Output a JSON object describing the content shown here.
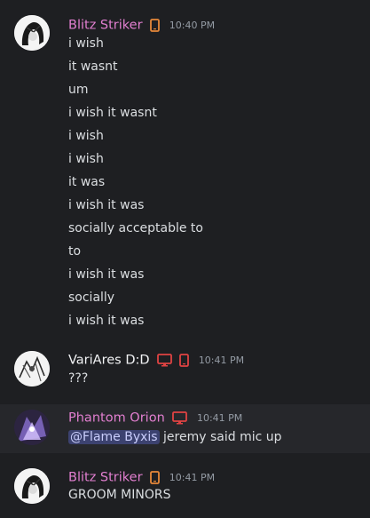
{
  "colors": {
    "background": "#1e1f22",
    "highlight_row": "#26272b",
    "pink_name": "#e27fd0",
    "white_name": "#f2f3f5",
    "timestamp": "#949ba4",
    "phone_icon_orange": "#e6883a",
    "device_icon_red": "#e04343",
    "mention_bg": "#3c4270"
  },
  "messages": [
    {
      "author": "Blitz Striker",
      "time": "10:40 PM",
      "icons": [
        "mobile-phone-icon"
      ],
      "lines": [
        "i wish",
        "it wasnt",
        "um",
        "i wish it wasnt",
        "i wish",
        "i wish",
        "it was",
        "i wish it was",
        "socially acceptable to",
        "to",
        "i wish it was",
        "socially",
        "i wish it was"
      ]
    },
    {
      "author": "VariAres D:D",
      "time": "10:41 PM",
      "icons": [
        "desktop-icon",
        "mobile-phone-icon"
      ],
      "lines": [
        "???"
      ]
    },
    {
      "author": "Phantom Orion",
      "time": "10:41 PM",
      "icons": [
        "desktop-icon"
      ],
      "mention": "@Flame Byxis",
      "text": " jeremy said mic up"
    },
    {
      "author": "Blitz Striker",
      "time": "10:41 PM",
      "icons": [
        "mobile-phone-icon"
      ],
      "lines": [
        "GROOM MINORS"
      ]
    }
  ]
}
